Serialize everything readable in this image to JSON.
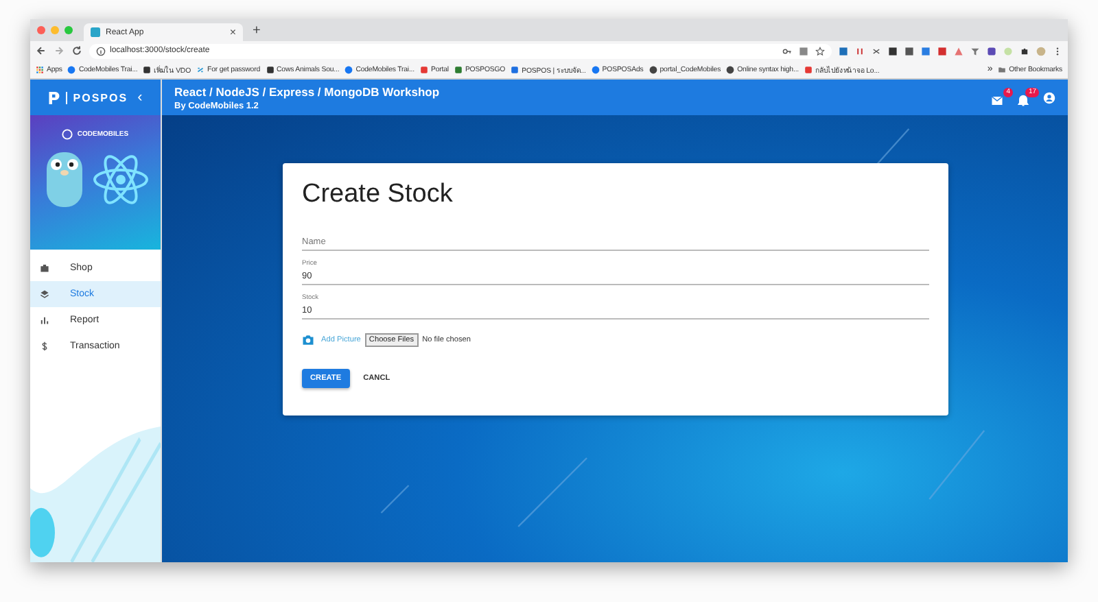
{
  "browser": {
    "tab_title": "React App",
    "tab_close": "×",
    "new_tab": "+",
    "address": "localhost:3000/stock/create",
    "bookmarks": [
      {
        "label": "Apps",
        "kind": "grid"
      },
      {
        "label": "CodeMobiles Trai...",
        "kind": "facebook"
      },
      {
        "label": "เพิ่มใน VDO",
        "kind": "square"
      },
      {
        "label": "For get password",
        "kind": "link"
      },
      {
        "label": "Cows Animals Sou...",
        "kind": "square"
      },
      {
        "label": "CodeMobiles Trai...",
        "kind": "facebook"
      },
      {
        "label": "Portal",
        "kind": "portal"
      },
      {
        "label": "POSPOSGO",
        "kind": "pospos"
      },
      {
        "label": "POSPOS | ระบบจัด...",
        "kind": "p"
      },
      {
        "label": "POSPOSAds",
        "kind": "facebook"
      },
      {
        "label": "portal_CodeMobiles",
        "kind": "globe"
      },
      {
        "label": "Online syntax high...",
        "kind": "globe"
      },
      {
        "label": "กลับไปยังหน้าจอ Lo...",
        "kind": "portal"
      }
    ],
    "more": "»",
    "other_bookmarks": "Other Bookmarks"
  },
  "app": {
    "brand": "POSPOS",
    "collapse": "‹",
    "title": "React / NodeJS / Express / MongoDB Workshop",
    "subtitle": "By CodeMobiles 1.2",
    "mail_badge": "4",
    "notification_badge": "17"
  },
  "sidebar": {
    "logo_text": "CODEMOBILES",
    "items": [
      {
        "label": "Shop",
        "kind": "shop",
        "selected": false
      },
      {
        "label": "Stock",
        "kind": "layers",
        "selected": true
      },
      {
        "label": "Report",
        "kind": "chart",
        "selected": false
      },
      {
        "label": "Transaction",
        "kind": "dollar",
        "selected": false
      }
    ]
  },
  "form": {
    "title": "Create Stock",
    "fields": [
      {
        "placeholder": "Name"
      },
      {
        "label": "Price",
        "value": "90"
      },
      {
        "label": "Stock",
        "value": "10"
      }
    ],
    "add_picture": "Add Picture",
    "file_button": "Choose Files",
    "file_status": "No file chosen",
    "buttons": [
      {
        "label": "CREATE",
        "kind": "primary"
      },
      {
        "label": "CANCL",
        "kind": "text"
      }
    ]
  }
}
